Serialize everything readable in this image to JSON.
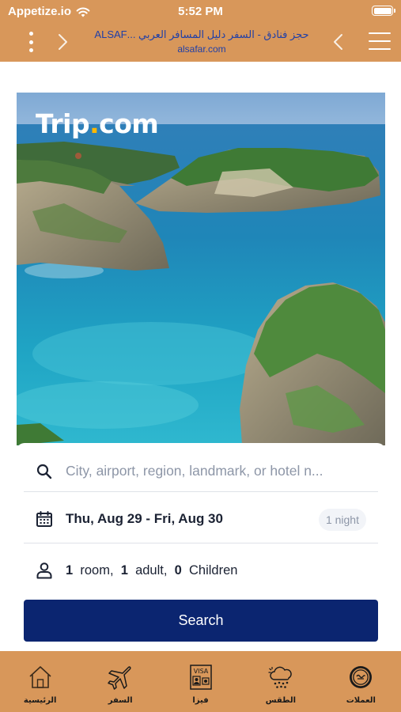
{
  "status_bar": {
    "carrier": "Appetize.io",
    "time": "5:52 PM",
    "wifi_icon": "wifi-icon",
    "battery_icon": "battery-icon"
  },
  "browser_header": {
    "title": "حجز فنادق - السفر دليل المسافر العربي ...ALSAF",
    "url": "alsafar.com",
    "color": "#d8975a",
    "title_color": "#1f3fa8"
  },
  "hero": {
    "logo_text": "Trip",
    "logo_dot": ".",
    "logo_suffix": "com"
  },
  "booking": {
    "search_placeholder": "City, airport, region, landmark, or hotel n...",
    "dates": "Thu, Aug 29 - Fri, Aug 30",
    "nights_badge": "1 night",
    "rooms_count": "1",
    "rooms_label": "room,",
    "adults_count": "1",
    "adults_label": "adult,",
    "children_count": "0",
    "children_label": "Children",
    "search_button": "Search",
    "button_color": "#0b2570"
  },
  "tab_bar": {
    "items": [
      {
        "label": "الرئيسية",
        "icon": "home-icon"
      },
      {
        "label": "السفر",
        "icon": "airplane-icon"
      },
      {
        "label": "فيزا",
        "icon": "visa-icon"
      },
      {
        "label": "الطقس",
        "icon": "weather-icon"
      },
      {
        "label": "العملات",
        "icon": "currency-icon"
      }
    ]
  }
}
